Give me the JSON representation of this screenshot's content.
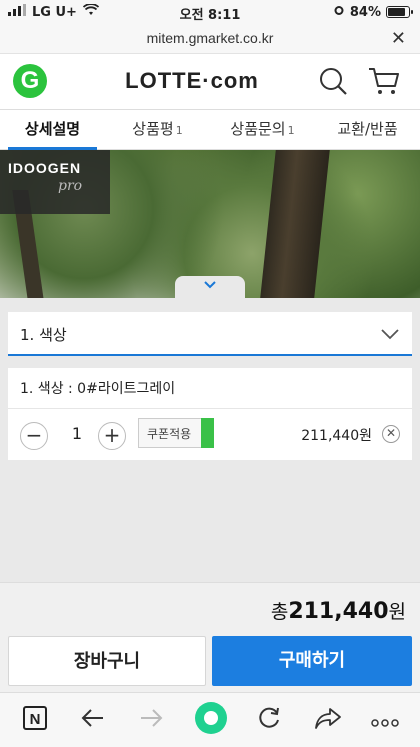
{
  "status": {
    "carrier": "LG U+",
    "time": "오전 8:11",
    "battery": "84%",
    "battery_level": 0.84
  },
  "urlbar": {
    "url": "mitem.gmarket.co.kr",
    "close": "✕"
  },
  "header": {
    "logo_letter": "G",
    "brand": "LOTTE·com"
  },
  "tabs": [
    {
      "label": "상세설명",
      "count": ""
    },
    {
      "label": "상품평",
      "count": "1"
    },
    {
      "label": "상품문의",
      "count": "1"
    },
    {
      "label": "교환/반품",
      "count": ""
    }
  ],
  "hero": {
    "badge_title": "IDOOGEN",
    "badge_sub": "pro"
  },
  "option": {
    "label": "1. 색상"
  },
  "selected": {
    "name": "1. 색상 : 0#라이트그레이",
    "qty": "1",
    "minus": "−",
    "plus": "+",
    "coupon": "쿠폰적용",
    "price": "211,440원",
    "remove": "✕"
  },
  "total": {
    "prefix": "총",
    "amount": "211,440",
    "unit": "원"
  },
  "buttons": {
    "cart": "장바구니",
    "buy": "구매하기"
  },
  "toolbar": {
    "n_label": "N"
  },
  "colors": {
    "accent": "#1c7ee0",
    "gmarket_green": "#2bc33d",
    "coupon_green": "#3ac148"
  }
}
